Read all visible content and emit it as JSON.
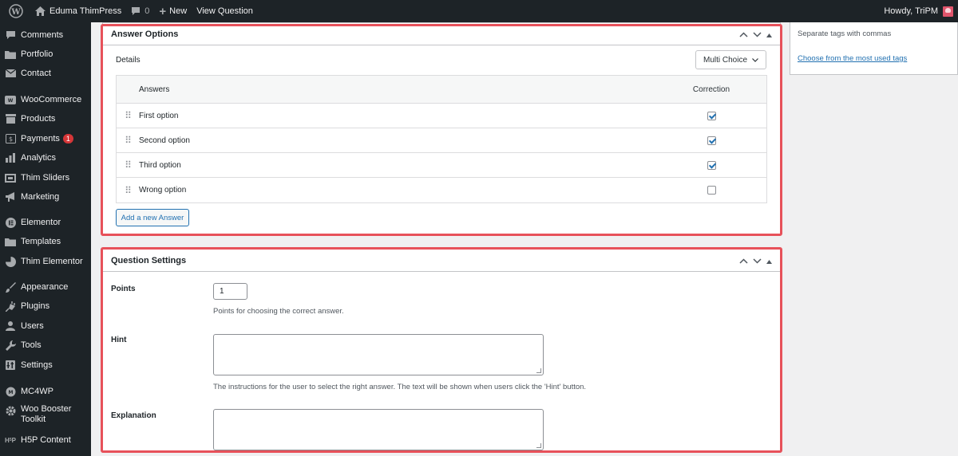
{
  "admin_bar": {
    "site_name": "Eduma ThimPress",
    "comments_count": "0",
    "new_label": "New",
    "view_label": "View Question",
    "howdy": "Howdy, TriPM"
  },
  "sidebar": {
    "items": [
      {
        "label": "Comments",
        "icon": "comment-icon"
      },
      {
        "label": "Portfolio",
        "icon": "folder-icon"
      },
      {
        "label": "Contact",
        "icon": "mail-icon"
      },
      {
        "label": "WooCommerce",
        "icon": "woo-icon"
      },
      {
        "label": "Products",
        "icon": "archive-icon"
      },
      {
        "label": "Payments",
        "icon": "dollar-icon",
        "badge": "1"
      },
      {
        "label": "Analytics",
        "icon": "bar-chart-icon"
      },
      {
        "label": "Thim Sliders",
        "icon": "slides-icon"
      },
      {
        "label": "Marketing",
        "icon": "megaphone-icon"
      },
      {
        "label": "Elementor",
        "icon": "elementor-icon"
      },
      {
        "label": "Templates",
        "icon": "folder-icon"
      },
      {
        "label": "Thim Elementor",
        "icon": "thim-icon"
      },
      {
        "label": "Appearance",
        "icon": "brush-icon"
      },
      {
        "label": "Plugins",
        "icon": "plug-icon"
      },
      {
        "label": "Users",
        "icon": "user-icon"
      },
      {
        "label": "Tools",
        "icon": "wrench-icon"
      },
      {
        "label": "Settings",
        "icon": "settings-icon"
      },
      {
        "label": "MC4WP",
        "icon": "mc4wp-icon"
      },
      {
        "label": "Woo Booster Toolkit",
        "icon": "gear-icon"
      },
      {
        "label": "H5P Content",
        "icon": "h5p-icon"
      }
    ]
  },
  "answer_options": {
    "title": "Answer Options",
    "details_label": "Details",
    "type_select": "Multi Choice",
    "col_answers": "Answers",
    "col_correction": "Correction",
    "answers": [
      {
        "label": "First option",
        "correct": true
      },
      {
        "label": "Second option",
        "correct": true
      },
      {
        "label": "Third option",
        "correct": true
      },
      {
        "label": "Wrong option",
        "correct": false
      }
    ],
    "add_button": "Add a new Answer"
  },
  "question_settings": {
    "title": "Question Settings",
    "points_label": "Points",
    "points_value": "1",
    "points_desc": "Points for choosing the correct answer.",
    "hint_label": "Hint",
    "hint_desc": "The instructions for the user to select the right answer. The text will be shown when users click the 'Hint' button.",
    "explanation_label": "Explanation"
  },
  "tags": {
    "hint": "Separate tags with commas",
    "link": "Choose from the most used tags"
  }
}
